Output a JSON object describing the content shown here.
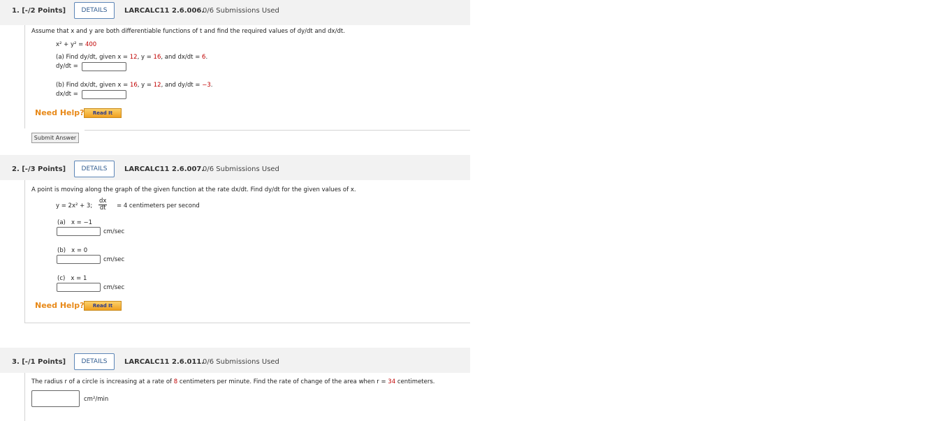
{
  "q1": {
    "points": "1. [-/2 Points]",
    "details": "DETAILS",
    "code": "LARCALC11 2.6.006.",
    "subs": "0/6 Submissions Used",
    "prompt": "Assume that x and y are both differentiable functions of t and find the required values of dy/dt and dx/dt.",
    "eq_lhs": "x² + y² =",
    "eq_rhs": "400",
    "a_pre": "(a) Find dy/dt, given x =",
    "a_x": "12",
    "a_mid1": ", y =",
    "a_y": "16",
    "a_mid2": ", and dx/dt =",
    "a_val": "6",
    "a_end": ".",
    "a_label": "dy/dt =",
    "b_pre": "(b) Find dx/dt, given x =",
    "b_x": "16",
    "b_mid1": ", y =",
    "b_y": "12",
    "b_mid2": ", and dy/dt =",
    "b_val": "−3",
    "b_end": ".",
    "b_label": "dx/dt =",
    "help": "Need Help?",
    "read": "Read It",
    "submit": "Submit Answer"
  },
  "q2": {
    "points": "2. [-/3 Points]",
    "details": "DETAILS",
    "code": "LARCALC11 2.6.007.",
    "subs": "0/6 Submissions Used",
    "prompt": "A point is moving along the graph of the given function at the rate dx/dt. Find dy/dt for the given values of x.",
    "func": "y = 2x² + 3;",
    "frac_num": "dx",
    "frac_den": "dt",
    "rate": "= 4 centimeters per second",
    "a_label": "(a)",
    "a_x": "x = −1",
    "b_label": "(b)",
    "b_x": "x = 0",
    "c_label": "(c)",
    "c_x": "x = 1",
    "unit": "cm/sec",
    "help": "Need Help?",
    "read": "Read It"
  },
  "q3": {
    "points": "3. [-/1 Points]",
    "details": "DETAILS",
    "code": "LARCALC11 2.6.011.",
    "subs": "0/6 Submissions Used",
    "prompt_pre": "The radius r of a circle is increasing at a rate of",
    "rate": "8",
    "prompt_mid": "centimeters per minute. Find the rate of change of the area when r =",
    "r_val": "34",
    "prompt_end": "centimeters.",
    "unit": "cm²/min"
  }
}
